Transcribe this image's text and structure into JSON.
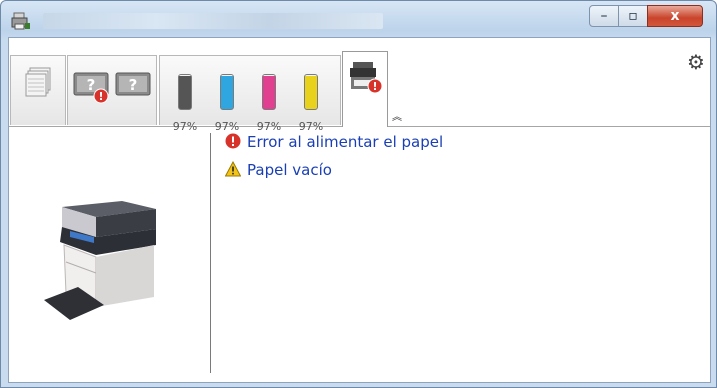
{
  "window": {
    "title": "",
    "controls": {
      "minimize": "–",
      "maximize": "▫",
      "close": "x"
    }
  },
  "toolbar": {
    "tabs": [
      {
        "name": "paper-tray-tab"
      },
      {
        "name": "unknown-status-tab"
      },
      {
        "name": "toner-tab"
      },
      {
        "name": "printer-status-tab",
        "active": true
      }
    ],
    "toners": [
      {
        "color": "#555555",
        "level_percent": 97,
        "label": "97%"
      },
      {
        "color": "#2fa6e0",
        "level_percent": 97,
        "label": "97%"
      },
      {
        "color": "#e0408f",
        "level_percent": 97,
        "label": "97%"
      },
      {
        "color": "#e8d21c",
        "level_percent": 97,
        "label": "97%"
      }
    ],
    "expander": "︽"
  },
  "messages": [
    {
      "type": "error",
      "text": "Error al alimentar el papel"
    },
    {
      "type": "warning",
      "text": "Papel vacío"
    }
  ],
  "colors": {
    "accent_link": "#1a3fb5",
    "error": "#d8332a",
    "warning": "#f2c318"
  }
}
